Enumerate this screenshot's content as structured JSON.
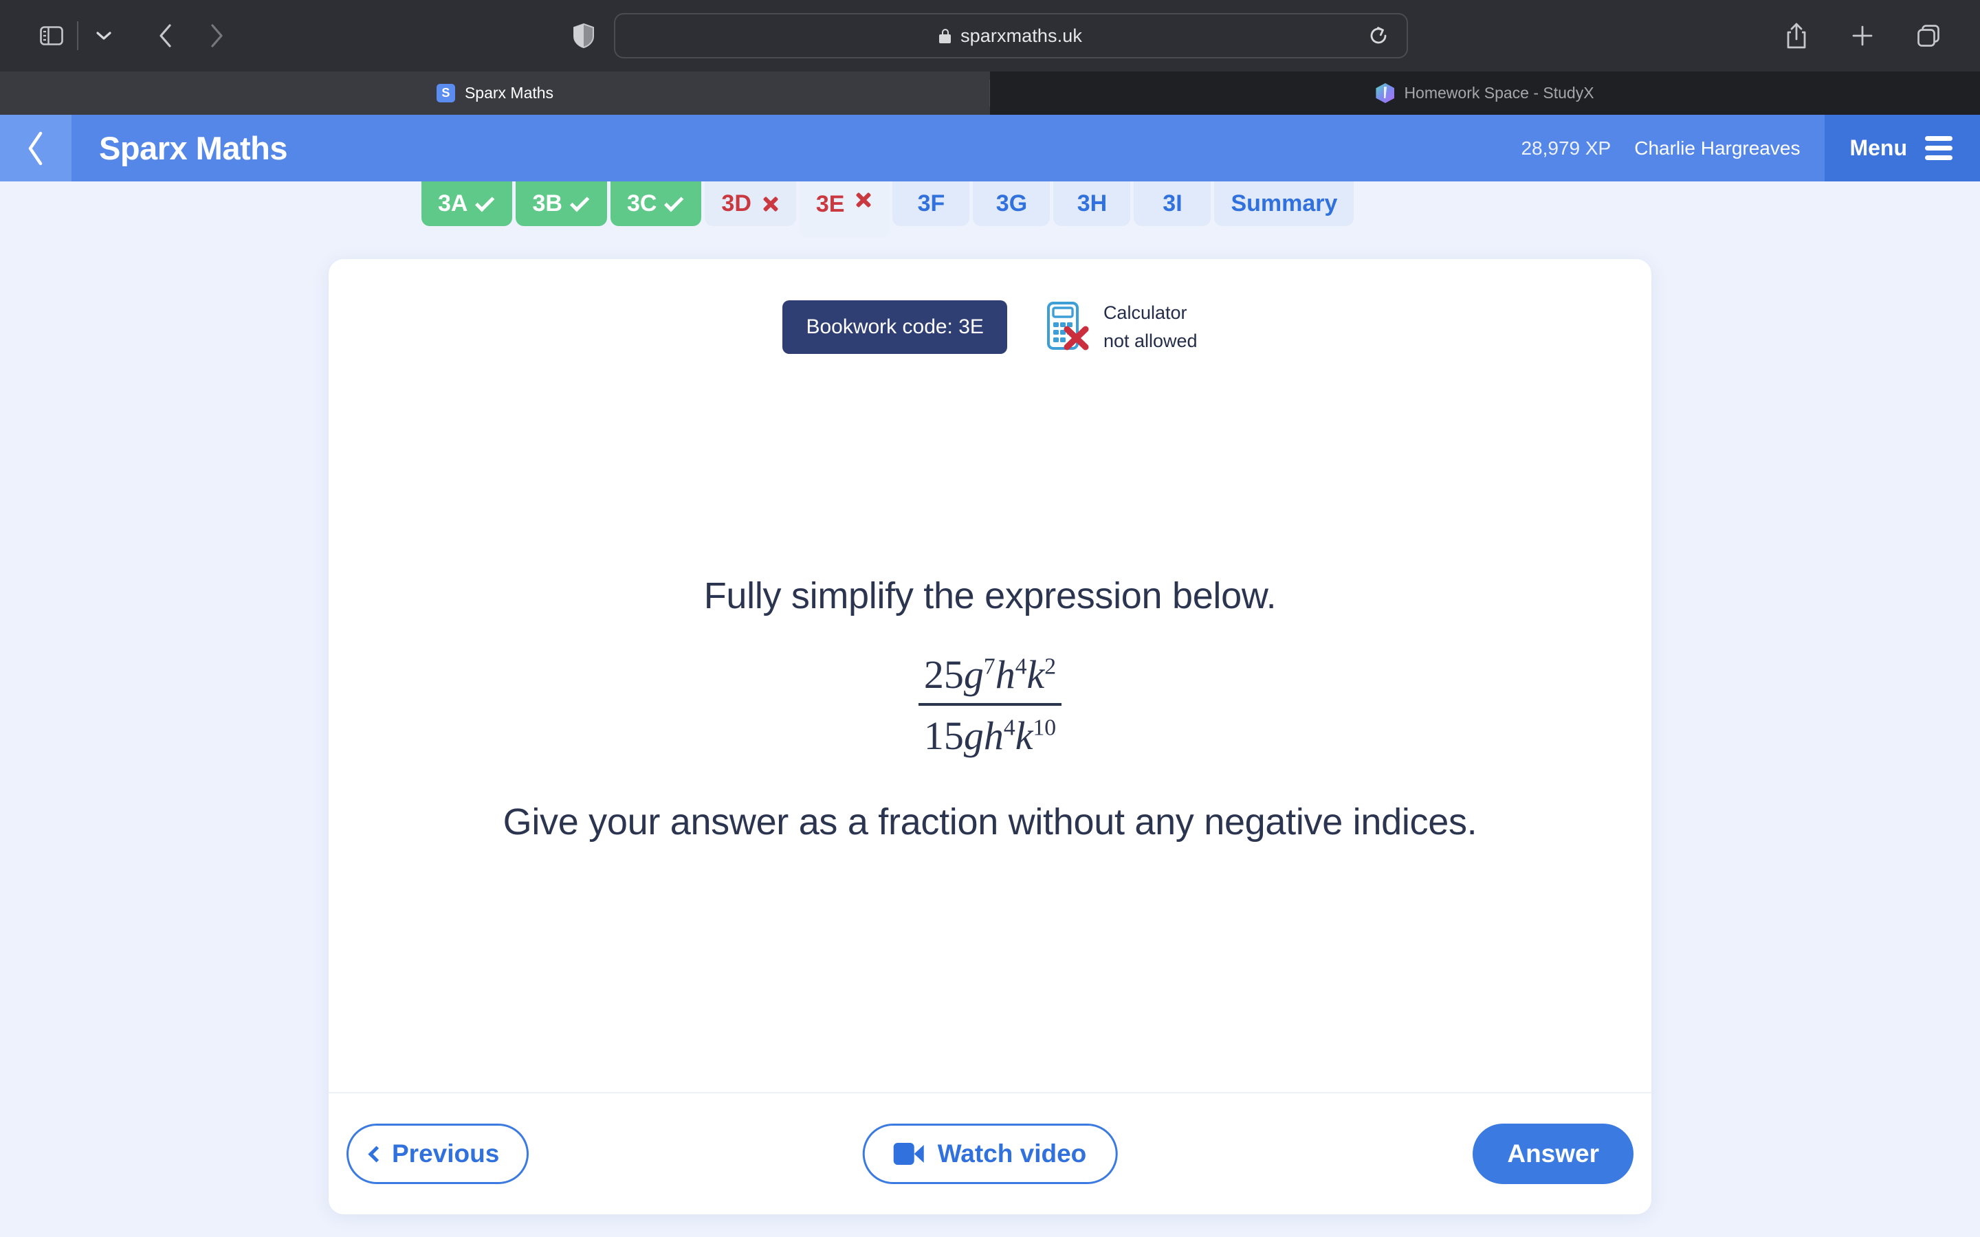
{
  "browser": {
    "url": "sparxmaths.uk",
    "icons": {
      "sidebar": "sidebar-toggle-icon",
      "chevron_down": "chevron-down-icon",
      "back": "back-arrow-icon",
      "forward": "forward-arrow-icon",
      "shield": "privacy-shield-icon",
      "lock": "lock-icon",
      "reload": "reload-icon",
      "share": "share-icon",
      "new_tab": "plus-icon",
      "tab_overview": "tab-overview-icon"
    },
    "tabs": [
      {
        "title": "Sparx Maths",
        "favicon": "sparx-s-favicon",
        "favicon_letter": "S",
        "active": true
      },
      {
        "title": "Homework Space - StudyX",
        "favicon": "studyx-hex-favicon",
        "active": false
      }
    ]
  },
  "app_header": {
    "back_icon": "chevron-left-icon",
    "title": "Sparx Maths",
    "xp": "28,979 XP",
    "user": "Charlie Hargreaves",
    "menu_label": "Menu",
    "menu_icon": "hamburger-icon",
    "colors": {
      "bar": "#5487e8",
      "back_panel": "#6d9bf0",
      "menu_panel": "#3d74db"
    }
  },
  "section_tabs": [
    {
      "label": "3A",
      "state": "done",
      "marker": "check"
    },
    {
      "label": "3B",
      "state": "done",
      "marker": "check"
    },
    {
      "label": "3C",
      "state": "done",
      "marker": "check"
    },
    {
      "label": "3D",
      "state": "wrong",
      "marker": "cross"
    },
    {
      "label": "3E",
      "state": "current",
      "marker": "cross"
    },
    {
      "label": "3F",
      "state": "todo",
      "marker": "none"
    },
    {
      "label": "3G",
      "state": "todo",
      "marker": "none"
    },
    {
      "label": "3H",
      "state": "todo",
      "marker": "none"
    },
    {
      "label": "3I",
      "state": "todo",
      "marker": "none"
    },
    {
      "label": "Summary",
      "state": "todo",
      "marker": "none"
    }
  ],
  "question": {
    "bookwork_code": "Bookwork code: 3E",
    "calculator_line1": "Calculator",
    "calculator_line2": "not allowed",
    "calculator_icon": "calculator-not-allowed-icon",
    "prompt": "Fully simplify the expression below.",
    "expression": {
      "numerator_coefficient": "25",
      "numerator_terms": [
        {
          "base": "g",
          "exp": "7"
        },
        {
          "base": "h",
          "exp": "4"
        },
        {
          "base": "k",
          "exp": "2"
        }
      ],
      "denominator_coefficient": "15",
      "denominator_terms": [
        {
          "base": "g",
          "exp": ""
        },
        {
          "base": "h",
          "exp": "4"
        },
        {
          "base": "k",
          "exp": "10"
        }
      ],
      "plain": "25g^7h^4k^2 / 15gh^4k^10"
    },
    "instruction": "Give your answer as a fraction without any negative indices."
  },
  "footer": {
    "previous_label": "Previous",
    "previous_icon": "chevron-left-icon",
    "watch_label": "Watch video",
    "watch_icon": "video-camera-icon",
    "answer_label": "Answer"
  },
  "colors": {
    "accent": "#3b7ae0",
    "page_bg": "#eef2fd",
    "correct": "#5fc98a",
    "incorrect": "#c9393f",
    "bookwork_badge": "#2f3f73"
  }
}
